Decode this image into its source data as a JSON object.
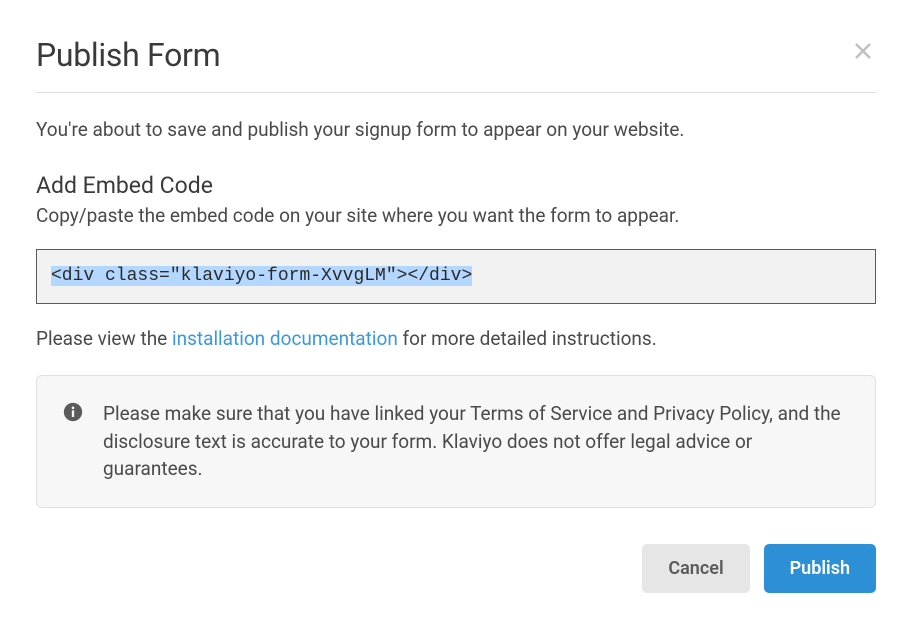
{
  "modal": {
    "title": "Publish Form",
    "intro": "You're about to save and publish your signup form to appear on your website."
  },
  "embed": {
    "heading": "Add Embed Code",
    "sub": "Copy/paste the embed code on your site where you want the form to appear.",
    "code": "<div class=\"klaviyo-form-XvvgLM\"></div>"
  },
  "docs": {
    "prefix": "Please view the ",
    "link_text": "installation documentation",
    "suffix": " for more detailed instructions."
  },
  "info": {
    "text": "Please make sure that you have linked your Terms of Service and Privacy Policy, and the disclosure text is accurate to your form. Klaviyo does not offer legal advice or guarantees."
  },
  "buttons": {
    "cancel": "Cancel",
    "publish": "Publish"
  }
}
